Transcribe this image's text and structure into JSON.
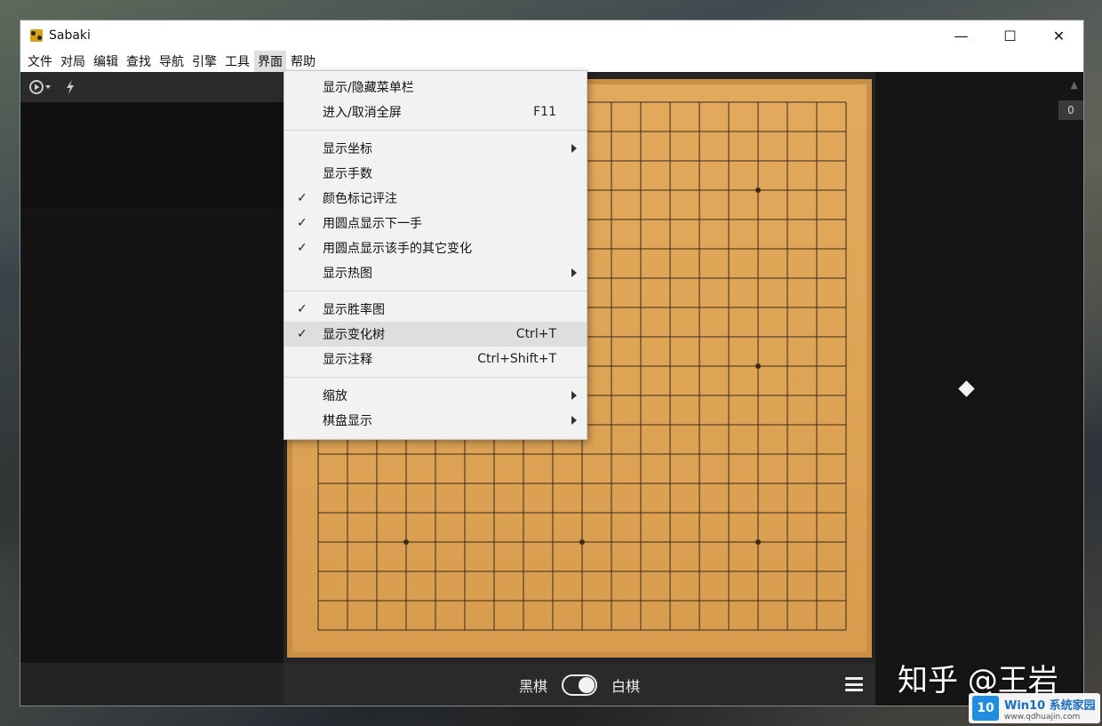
{
  "window": {
    "title": "Sabaki",
    "controls": {
      "minimize": "—",
      "maximize": "☐",
      "close": "✕"
    }
  },
  "menubar": {
    "items": [
      "文件",
      "对局",
      "编辑",
      "查找",
      "导航",
      "引擎",
      "工具",
      "界面",
      "帮助"
    ],
    "active_index": 7
  },
  "dropdown": {
    "groups": [
      [
        {
          "label": "显示/隐藏菜单栏",
          "checked": false,
          "accel": "",
          "submenu": false
        },
        {
          "label": "进入/取消全屏",
          "checked": false,
          "accel": "F11",
          "submenu": false
        }
      ],
      [
        {
          "label": "显示坐标",
          "checked": false,
          "accel": "",
          "submenu": true
        },
        {
          "label": "显示手数",
          "checked": false,
          "accel": "",
          "submenu": false
        },
        {
          "label": "颜色标记评注",
          "checked": true,
          "accel": "",
          "submenu": false
        },
        {
          "label": "用圆点显示下一手",
          "checked": true,
          "accel": "",
          "submenu": false
        },
        {
          "label": "用圆点显示该手的其它变化",
          "checked": true,
          "accel": "",
          "submenu": false
        },
        {
          "label": "显示热图",
          "checked": false,
          "accel": "",
          "submenu": true
        }
      ],
      [
        {
          "label": "显示胜率图",
          "checked": true,
          "accel": "",
          "submenu": false
        },
        {
          "label": "显示变化树",
          "checked": true,
          "accel": "Ctrl+T",
          "submenu": false,
          "hover": true
        },
        {
          "label": "显示注释",
          "checked": false,
          "accel": "Ctrl+Shift+T",
          "submenu": false
        }
      ],
      [
        {
          "label": "缩放",
          "checked": false,
          "accel": "",
          "submenu": true
        },
        {
          "label": "棋盘显示",
          "checked": false,
          "accel": "",
          "submenu": true
        }
      ]
    ],
    "check_glyph": "✓"
  },
  "board": {
    "size": 19,
    "line_color": "#3b2a1a",
    "wood_color": "#e0a55a"
  },
  "bottom_bar": {
    "black_label": "黑棋",
    "white_label": "白棋"
  },
  "right_panel": {
    "move_count": "0"
  },
  "watermark": {
    "text": "知乎 @王岩"
  },
  "logo_badge": {
    "mark": "10",
    "main": "Win10 系统家园",
    "sub": "www.qdhuajin.com"
  }
}
